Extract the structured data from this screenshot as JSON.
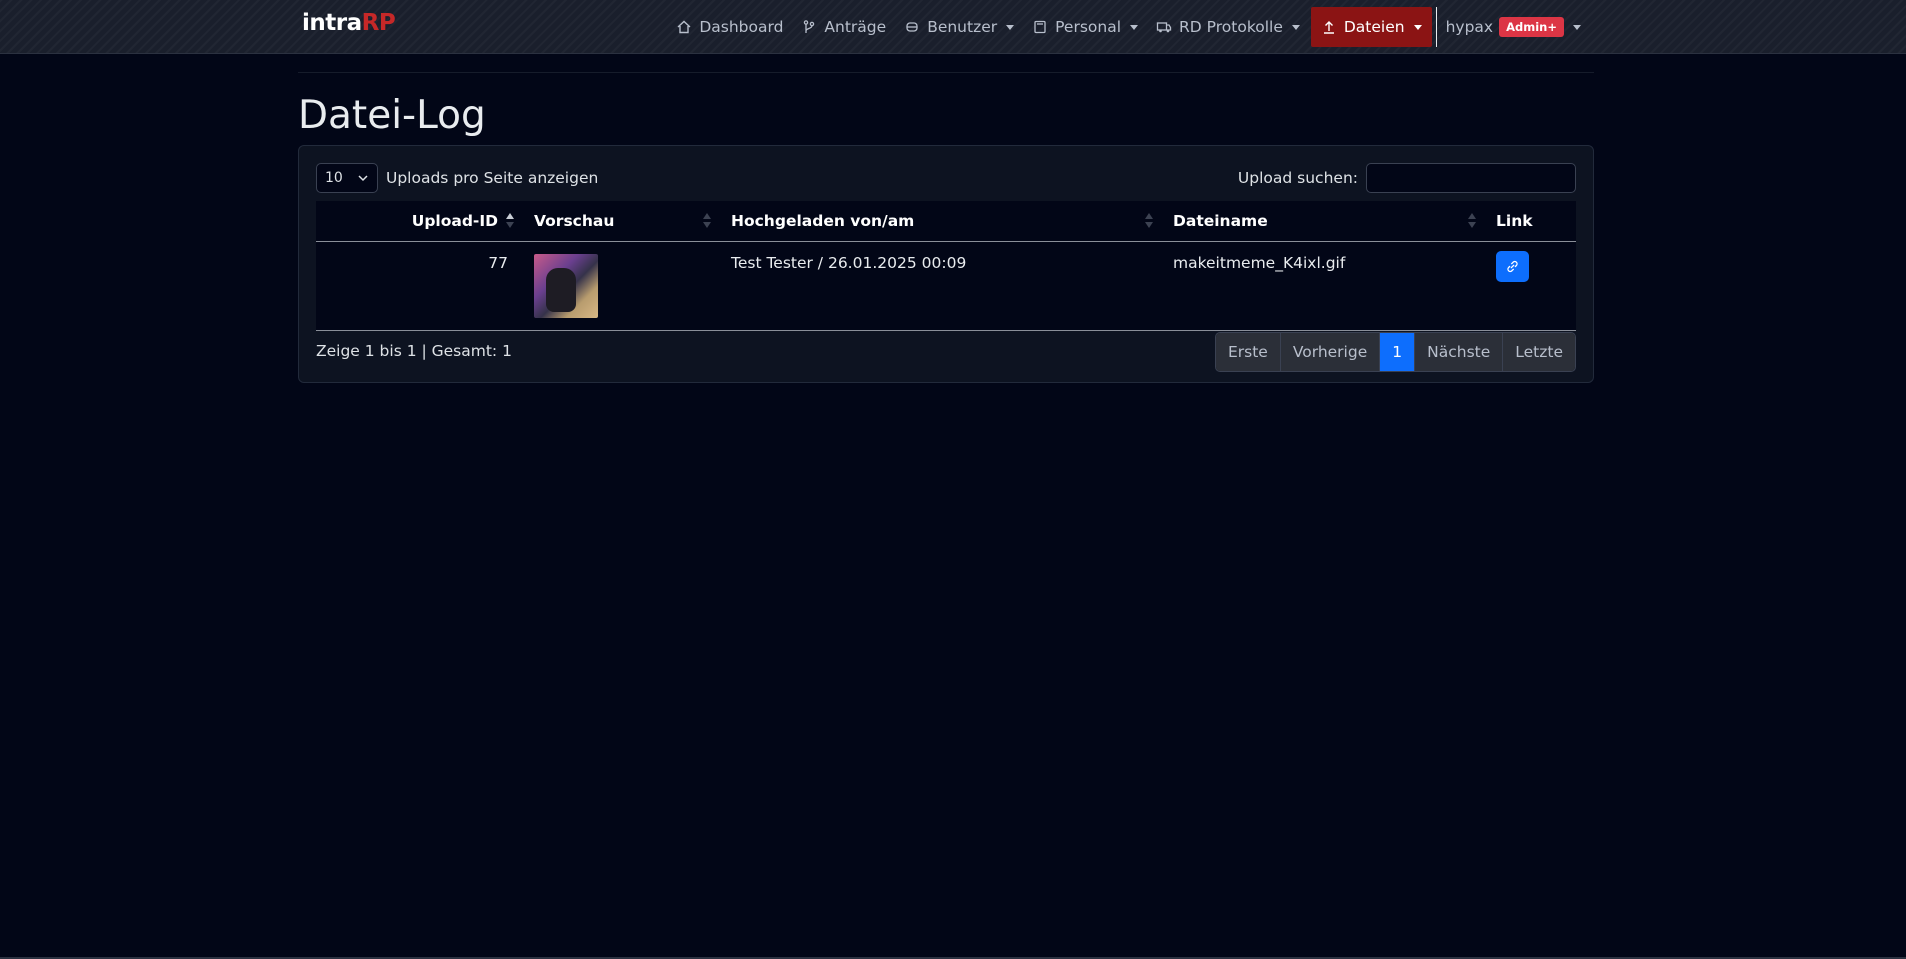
{
  "brand": {
    "part1": "intra",
    "part2": "RP"
  },
  "nav": {
    "dashboard": "Dashboard",
    "antraege": "Anträge",
    "benutzer": "Benutzer",
    "personal": "Personal",
    "rd_protokolle": "RD Protokolle",
    "dateien": "Dateien",
    "user": "hypax",
    "user_badge": "Admin+"
  },
  "page": {
    "title": "Datei-Log"
  },
  "table_controls": {
    "length_value": "10",
    "length_label": "Uploads pro Seite anzeigen",
    "search_label": "Upload suchen:",
    "search_value": ""
  },
  "table": {
    "headers": [
      "Upload-ID",
      "Vorschau",
      "Hochgeladen von/am",
      "Dateiname",
      "Link"
    ],
    "rows": [
      {
        "id": "77",
        "preview": "image preview (cat)",
        "uploaded": "Test Tester / 26.01.2025 00:09",
        "filename": "makeitmeme_K4ixl.gif",
        "link_icon": "link-icon"
      }
    ]
  },
  "footer": {
    "info": "Zeige 1 bis 1 | Gesamt: 1",
    "pagination": [
      "Erste",
      "Vorherige",
      "1",
      "Nächste",
      "Letzte"
    ],
    "active_page": "1"
  },
  "colors": {
    "background": "#020617",
    "navbar": "#1a1f2c",
    "active_nav": "#8b1414",
    "brand_accent": "#c62828",
    "primary": "#0d6efd",
    "badge": "#dc3545"
  }
}
